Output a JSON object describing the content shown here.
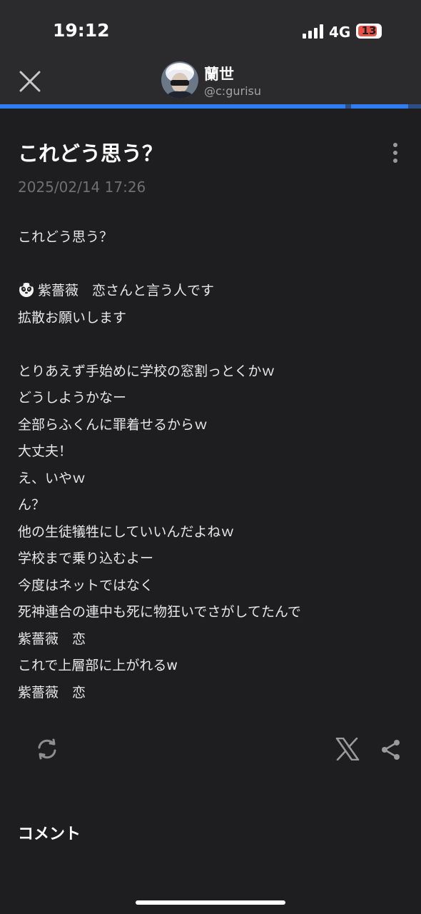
{
  "status_bar": {
    "time": "19:12",
    "network": "4G",
    "battery": "13"
  },
  "header": {
    "author_name": "蘭世",
    "author_handle": "@c:gurisu",
    "read_progress": 0.82
  },
  "post": {
    "title": "これどう思う？",
    "date": "2025/02/14 17:26",
    "body_lines": [
      "これどう思う？",
      "",
      "紫薔薇　恋さんと言う人です",
      "拡散お願いします",
      "",
      "とりあえず手始めに学校の窓割っとくかｗ",
      "どうしようかなー",
      "全部らふくんに罪着せるからｗ",
      "大丈夫！",
      "え、いやｗ",
      "ん？",
      "他の生徒犠牲にしていいんだよねｗ",
      "学校まで乗り込むよー",
      "今度はネットではなく",
      "死神連合の連中も死に物狂いでさがしてたんで",
      "紫薔薇　恋",
      "これで上層部に上がれるw",
      "紫薔薇　恋"
    ],
    "emoji_line_index": 2,
    "emoji": "panda-face"
  },
  "actions": {
    "refresh_icon": "refresh-icon",
    "x_icon": "x-logo-icon",
    "share_icon": "share-icon"
  },
  "comments": {
    "heading": "コメント"
  },
  "colors": {
    "background": "#1e1e20",
    "topbar": "#2b2b2d",
    "accent": "#2f7df0"
  }
}
